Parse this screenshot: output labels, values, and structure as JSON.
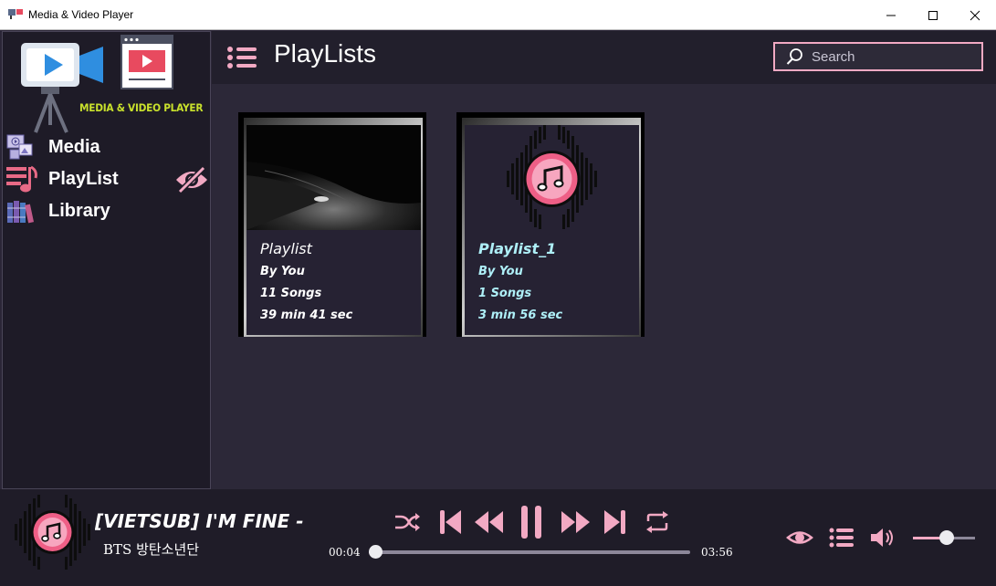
{
  "window": {
    "title": "Media & Video Player"
  },
  "sidebar": {
    "logo_text": "MEDIA & VIDEO PLAYER",
    "items": [
      {
        "label": "Media",
        "icon": "media-icon"
      },
      {
        "label": "PlayList",
        "icon": "playlist-icon"
      },
      {
        "label": "Library",
        "icon": "library-icon"
      }
    ],
    "hide_icon": "eye-slash-icon"
  },
  "header": {
    "title": "PlayLists",
    "search_placeholder": "Search"
  },
  "playlists": [
    {
      "title": "Playlist",
      "author": "By You",
      "songs": "11 Songs",
      "duration": "39 min 41 sec"
    },
    {
      "title": "Playlist_1",
      "author": "By You",
      "songs": "1 Songs",
      "duration": "3 min 56 sec"
    }
  ],
  "player": {
    "song_title": "[VIETSUB] I'M FINE - BTS",
    "artist": "BTS 방탄소년단",
    "current_time": "00:04",
    "total_time": "03:56",
    "progress": 0.02,
    "volume": 0.55
  },
  "colors": {
    "accent": "#f2a9c3",
    "background": "#2c2838",
    "sidebar": "#1e1b27",
    "playlist_alt_text": "#aeeff7"
  }
}
